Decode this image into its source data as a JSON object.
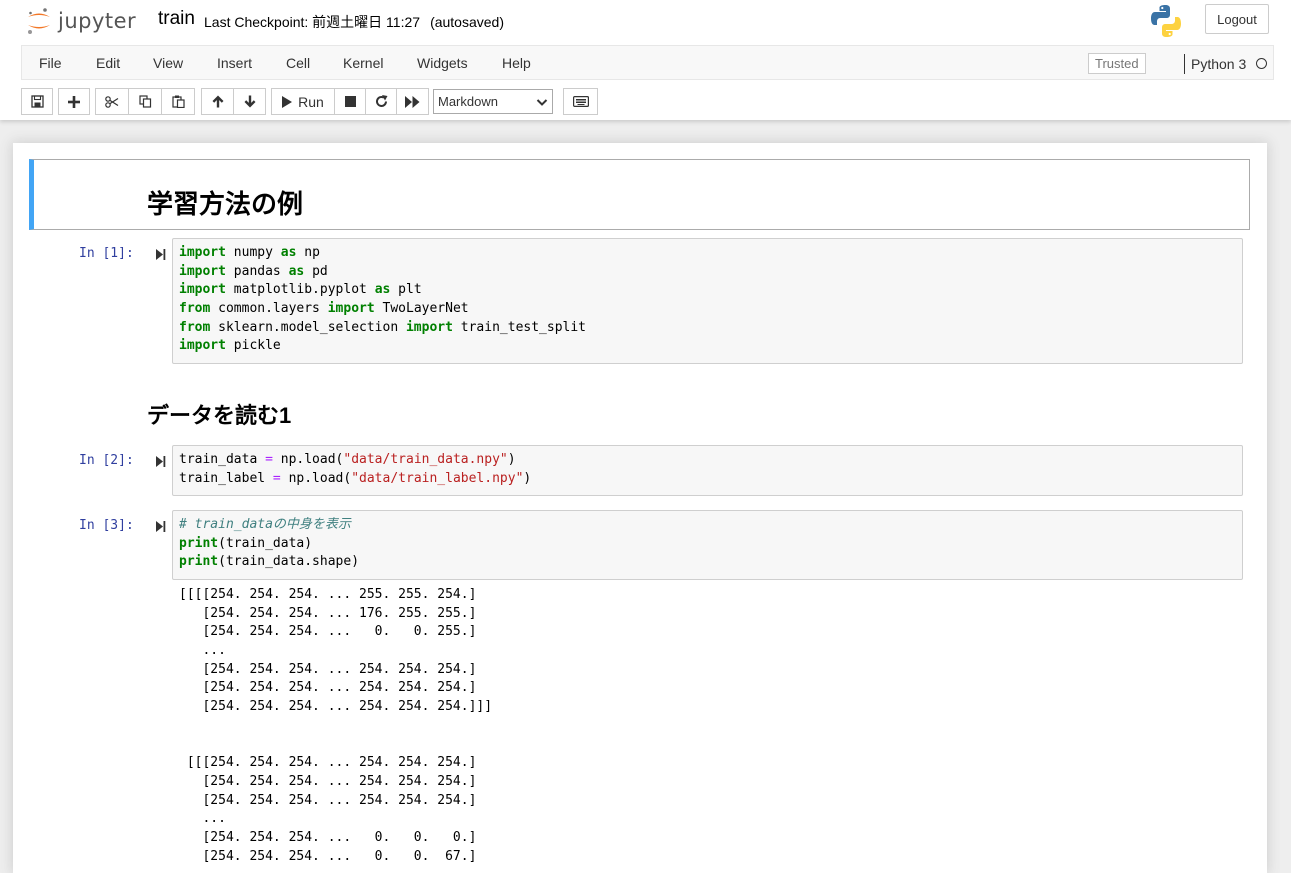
{
  "header": {
    "logo_text": "jupyter",
    "notebook_name": "train",
    "checkpoint_label": "Last Checkpoint: 前週土曜日 11:27",
    "autosave_status": "(autosaved)",
    "logout_label": "Logout"
  },
  "menu": {
    "items": [
      "File",
      "Edit",
      "View",
      "Insert",
      "Cell",
      "Kernel",
      "Widgets",
      "Help"
    ],
    "trusted_label": "Trusted",
    "kernel_name": "Python 3"
  },
  "toolbar": {
    "run_label": "Run",
    "cell_type": "Markdown"
  },
  "cells": {
    "title": "学習方法の例",
    "section1": "データを読む1",
    "prompts": [
      "In [1]:",
      "In [2]:",
      "In [3]:"
    ],
    "code1": [
      [
        [
          "kw",
          "import"
        ],
        [
          "",
          " numpy "
        ],
        [
          "kw",
          "as"
        ],
        [
          "",
          " np"
        ]
      ],
      [
        [
          "kw",
          "import"
        ],
        [
          "",
          " pandas "
        ],
        [
          "kw",
          "as"
        ],
        [
          "",
          " pd"
        ]
      ],
      [
        [
          "kw",
          "import"
        ],
        [
          "",
          " matplotlib.pyplot "
        ],
        [
          "kw",
          "as"
        ],
        [
          "",
          " plt"
        ]
      ],
      [
        [
          "kw",
          "from"
        ],
        [
          "",
          " common.layers "
        ],
        [
          "kw",
          "import"
        ],
        [
          "",
          " TwoLayerNet"
        ]
      ],
      [
        [
          "kw",
          "from"
        ],
        [
          "",
          " sklearn.model_selection "
        ],
        [
          "kw",
          "import"
        ],
        [
          "",
          " train_test_split"
        ]
      ],
      [
        [
          "kw",
          "import"
        ],
        [
          "",
          " pickle"
        ]
      ]
    ],
    "code2": [
      [
        [
          "",
          "train_data "
        ],
        [
          "op",
          "="
        ],
        [
          "",
          " np.load("
        ],
        [
          "str",
          "\"data/train_data.npy\""
        ],
        [
          "",
          ")"
        ]
      ],
      [
        [
          "",
          "train_label "
        ],
        [
          "op",
          "="
        ],
        [
          "",
          " np.load("
        ],
        [
          "str",
          "\"data/train_label.npy\""
        ],
        [
          "",
          ")"
        ]
      ]
    ],
    "code3": [
      [
        [
          "cm",
          "# train_dataの中身を表示"
        ]
      ],
      [
        [
          "kw2",
          "print"
        ],
        [
          "",
          "(train_data)"
        ]
      ],
      [
        [
          "kw2",
          "print"
        ],
        [
          "",
          "(train_data.shape)"
        ]
      ]
    ],
    "output3": [
      "[[[[254. 254. 254. ... 255. 255. 254.]",
      "   [254. 254. 254. ... 176. 255. 255.]",
      "   [254. 254. 254. ...   0.   0. 255.]",
      "   ...",
      "   [254. 254. 254. ... 254. 254. 254.]",
      "   [254. 254. 254. ... 254. 254. 254.]",
      "   [254. 254. 254. ... 254. 254. 254.]]]",
      "",
      "",
      " [[[254. 254. 254. ... 254. 254. 254.]",
      "   [254. 254. 254. ... 254. 254. 254.]",
      "   [254. 254. 254. ... 254. 254. 254.]",
      "   ...",
      "   [254. 254. 254. ...   0.   0.   0.]",
      "   [254. 254. 254. ...   0.   0.  67.]"
    ]
  }
}
